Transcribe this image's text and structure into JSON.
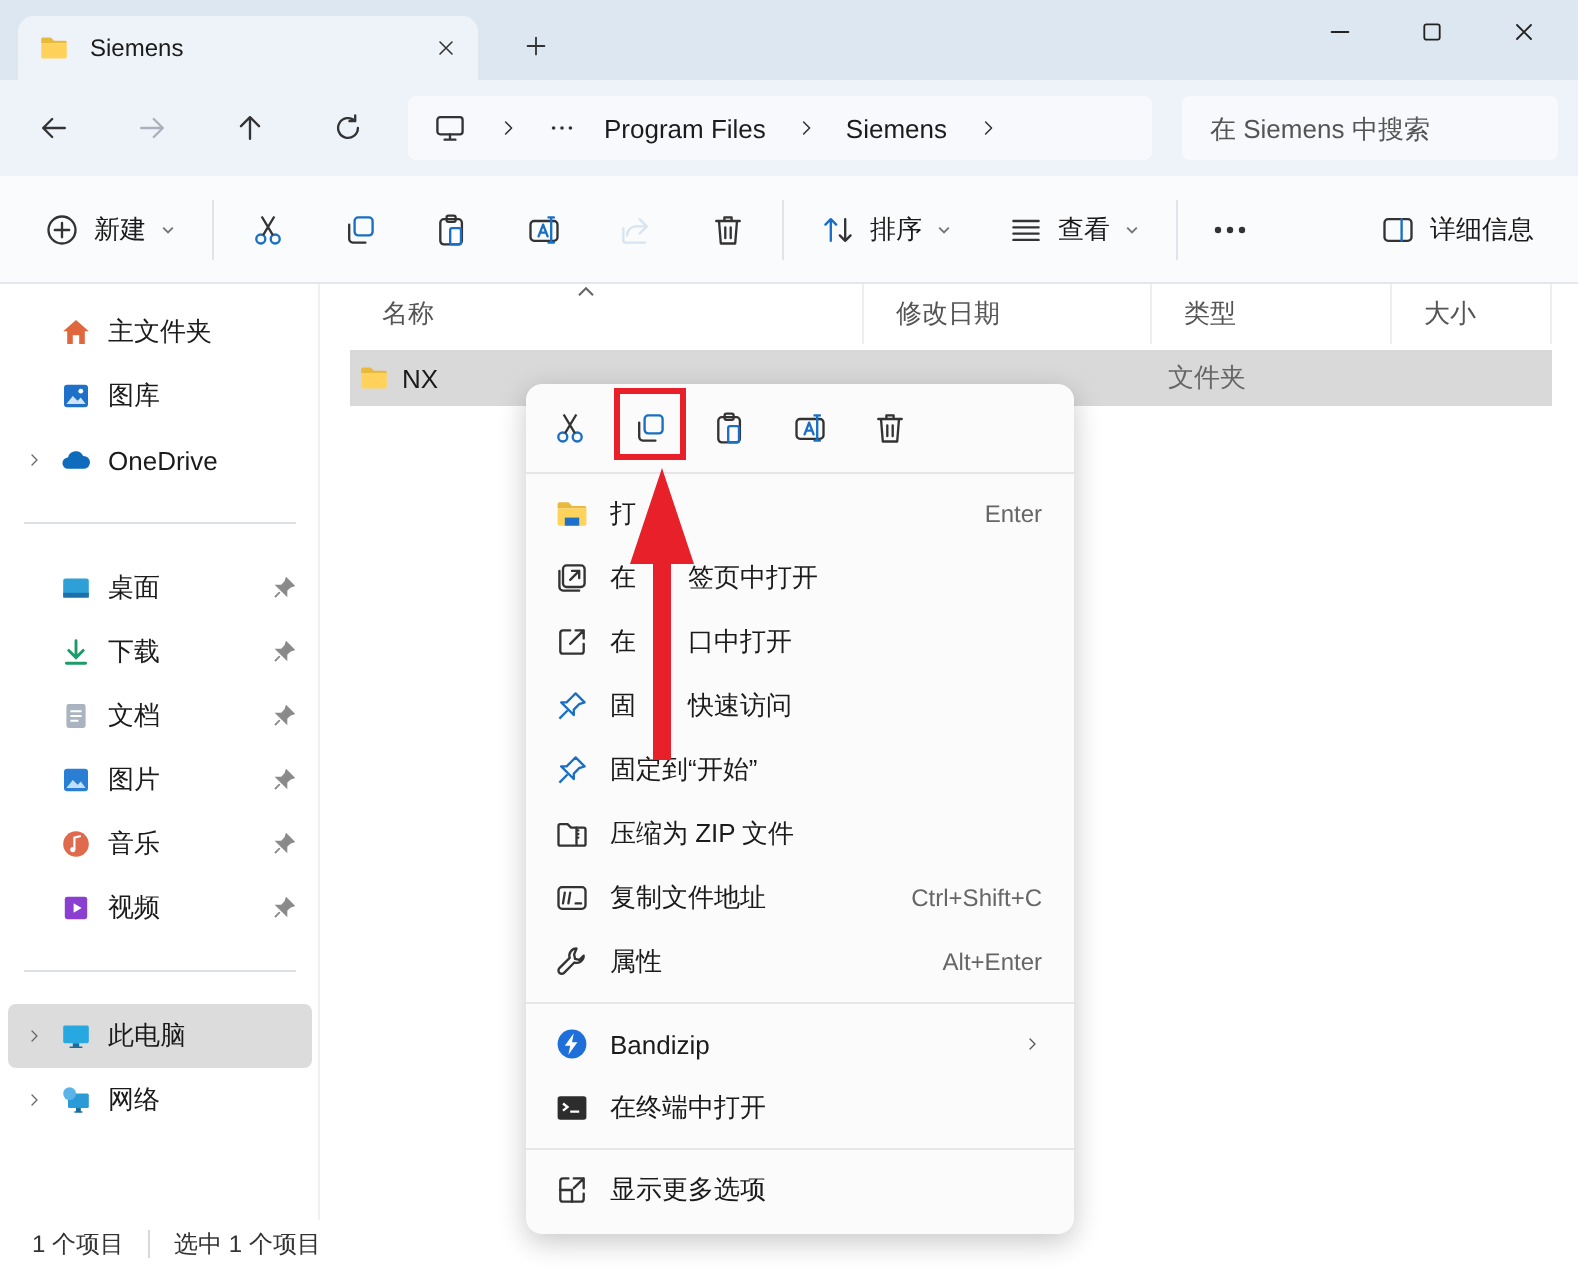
{
  "window": {
    "tab_title": "Siemens"
  },
  "address_bar": {
    "breadcrumbs": [
      "Program Files",
      "Siemens"
    ],
    "search": {
      "placeholder": "在 Siemens 中搜索"
    }
  },
  "toolbar": {
    "items": [
      {
        "kind": "new",
        "label": "新建",
        "disabled": false
      },
      {
        "kind": "cut",
        "disabled": false
      },
      {
        "kind": "copy",
        "disabled": false
      },
      {
        "kind": "paste",
        "disabled": false
      },
      {
        "kind": "rename",
        "disabled": false
      },
      {
        "kind": "share",
        "disabled": true
      },
      {
        "kind": "delete",
        "disabled": false
      },
      {
        "kind": "sort",
        "label": "排序",
        "disabled": false
      },
      {
        "kind": "view",
        "label": "查看",
        "disabled": false
      },
      {
        "kind": "more",
        "disabled": false
      }
    ],
    "details": {
      "label": "详细信息"
    }
  },
  "sidebar": {
    "sections": [
      [
        {
          "kind": "home",
          "label": "主文件夹",
          "expandable": false,
          "pinned": false,
          "selected": false
        },
        {
          "kind": "gallery",
          "label": "图库",
          "expandable": false,
          "pinned": false,
          "selected": false
        },
        {
          "kind": "cloud",
          "label": "OneDrive",
          "expandable": true,
          "pinned": false,
          "selected": false
        }
      ],
      [
        {
          "kind": "desktop",
          "label": "桌面",
          "expandable": false,
          "pinned": true,
          "selected": false
        },
        {
          "kind": "download",
          "label": "下载",
          "expandable": false,
          "pinned": true,
          "selected": false
        },
        {
          "kind": "document",
          "label": "文档",
          "expandable": false,
          "pinned": true,
          "selected": false
        },
        {
          "kind": "pictures",
          "label": "图片",
          "expandable": false,
          "pinned": true,
          "selected": false
        },
        {
          "kind": "music",
          "label": "音乐",
          "expandable": false,
          "pinned": true,
          "selected": false
        },
        {
          "kind": "video",
          "label": "视频",
          "expandable": false,
          "pinned": true,
          "selected": false
        }
      ],
      [
        {
          "kind": "pc",
          "label": "此电脑",
          "expandable": true,
          "pinned": false,
          "selected": true
        },
        {
          "kind": "network",
          "label": "网络",
          "expandable": true,
          "pinned": false,
          "selected": false
        }
      ]
    ]
  },
  "table": {
    "columns": [
      "名称",
      "修改日期",
      "类型",
      "大小"
    ],
    "rows": [
      {
        "name": "NX",
        "type": "文件夹",
        "selected": true
      }
    ]
  },
  "context_menu": {
    "quick_actions": [
      {
        "kind": "cut",
        "highlighted": false
      },
      {
        "kind": "copy",
        "highlighted": true
      },
      {
        "kind": "paste",
        "highlighted": false
      },
      {
        "kind": "rename",
        "highlighted": false
      },
      {
        "kind": "delete",
        "highlighted": false
      }
    ],
    "groups": [
      [
        {
          "kind": "open",
          "label_parts": [
            "打"
          ],
          "shortcut": "Enter",
          "submenu": false
        },
        {
          "kind": "new-tab",
          "label_parts": [
            "在",
            "签页中打开"
          ],
          "submenu": false
        },
        {
          "kind": "new-window",
          "label_parts": [
            "在",
            "口中打开"
          ],
          "submenu": false
        },
        {
          "kind": "pin",
          "label_parts": [
            "固",
            "快速访问"
          ],
          "submenu": false
        },
        {
          "kind": "pin",
          "label_parts": [
            "固定到“开始”"
          ],
          "submenu": false
        },
        {
          "kind": "zip",
          "label_parts": [
            "压缩为 ZIP 文件"
          ],
          "submenu": false
        },
        {
          "kind": "copy-path",
          "label_parts": [
            "复制文件地址"
          ],
          "shortcut": "Ctrl+Shift+C",
          "submenu": false
        },
        {
          "kind": "properties",
          "label_parts": [
            "属性"
          ],
          "shortcut": "Alt+Enter",
          "submenu": false
        }
      ],
      [
        {
          "kind": "bandizip",
          "label_parts": [
            "Bandizip"
          ],
          "submenu": true
        },
        {
          "kind": "terminal",
          "label_parts": [
            "在终端中打开"
          ],
          "submenu": false
        }
      ],
      [
        {
          "kind": "more-options",
          "label_parts": [
            "显示更多选项"
          ],
          "submenu": false
        }
      ]
    ]
  },
  "status_bar": {
    "item_count": "1 个项目",
    "selection": "选中 1 个项目"
  }
}
